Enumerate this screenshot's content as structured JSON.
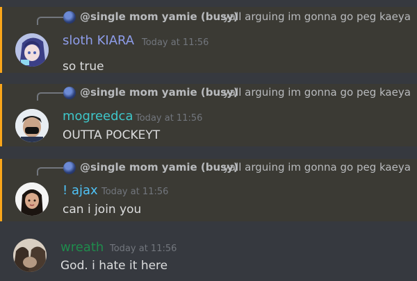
{
  "messages": [
    {
      "reply_to": {
        "name": "@single mom yamie (busy)",
        "text": "yall arguing im gonna go  peg kaeya"
      },
      "author": "sloth KIARA",
      "author_color": "#8e9dea",
      "timestamp": "Today at 11:56",
      "content": "so true",
      "avatar_icon": "anime-avatar"
    },
    {
      "reply_to": {
        "name": "@single mom yamie (busy)",
        "text": "yall arguing im gonna go  peg kaeya"
      },
      "author": "mogreedca",
      "author_color": "#3ec6c9",
      "timestamp": "Today at 11:56",
      "content": "OUTTA POCKEYT",
      "avatar_icon": "masked-person-avatar"
    },
    {
      "reply_to": {
        "name": "@single mom yamie (busy)",
        "text": "yall arguing im gonna go  peg kaeya"
      },
      "author": "! ajax",
      "author_color": "#4fc3f7",
      "timestamp": "Today at 11:56",
      "content": "can i join you",
      "avatar_icon": "dark-hair-avatar"
    },
    {
      "author": "wreath",
      "author_color": "#1f8b4c",
      "timestamp": "Today at 11:56",
      "content": "God. i hate it here",
      "avatar_icon": "sepia-avatar"
    }
  ],
  "highlight_color": "#faa61a"
}
